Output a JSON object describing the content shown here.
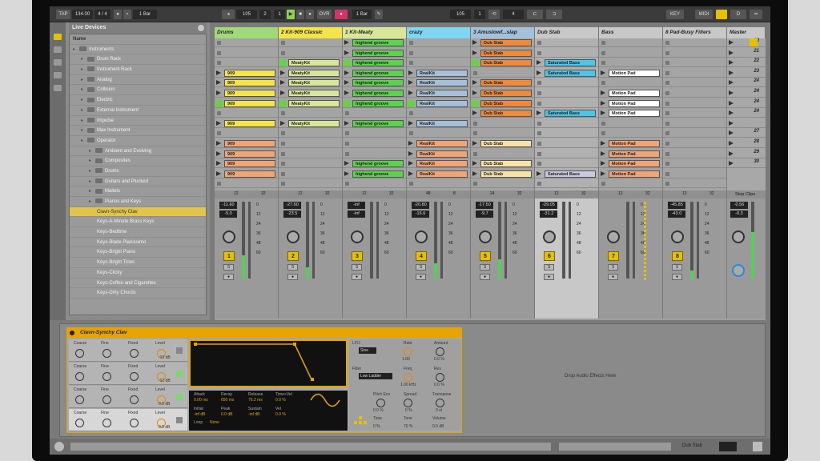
{
  "transport": {
    "tap": "TAP",
    "tempo": "134.00",
    "meter": "4 / 4",
    "loop_pos": "1 Bar",
    "ovr": "OVR",
    "key": "KEY",
    "midi": "MIDI",
    "global_quant": "1 Bar"
  },
  "browser": {
    "title": "Live Devices",
    "items": [
      {
        "label": "Name",
        "indent": 0,
        "type": "head"
      },
      {
        "label": "Instruments",
        "indent": 0,
        "type": "folder"
      },
      {
        "label": "Drum Rack",
        "indent": 1,
        "type": "folder"
      },
      {
        "label": "Instrument Rack",
        "indent": 1,
        "type": "folder"
      },
      {
        "label": "Analog",
        "indent": 1,
        "type": "folder"
      },
      {
        "label": "Collision",
        "indent": 1,
        "type": "folder"
      },
      {
        "label": "Electric",
        "indent": 1,
        "type": "folder"
      },
      {
        "label": "External Instrument",
        "indent": 1,
        "type": "folder"
      },
      {
        "label": "Impulse",
        "indent": 1,
        "type": "folder"
      },
      {
        "label": "Max Instrument",
        "indent": 1,
        "type": "folder"
      },
      {
        "label": "Operator",
        "indent": 1,
        "type": "folder"
      },
      {
        "label": "Ambient and Evolving",
        "indent": 2,
        "type": "folder"
      },
      {
        "label": "Composites",
        "indent": 2,
        "type": "folder"
      },
      {
        "label": "Drums",
        "indent": 2,
        "type": "folder"
      },
      {
        "label": "Guitars and Plucked",
        "indent": 2,
        "type": "folder"
      },
      {
        "label": "Mallets",
        "indent": 2,
        "type": "folder"
      },
      {
        "label": "Pianos and Keys",
        "indent": 2,
        "type": "folder"
      },
      {
        "label": "Clavn-Synchy Clav",
        "indent": 3,
        "type": "item",
        "selected": true
      },
      {
        "label": "Keys-A-Minute Brass Keys",
        "indent": 3,
        "type": "item"
      },
      {
        "label": "Keys-Bedtime",
        "indent": 3,
        "type": "item"
      },
      {
        "label": "Keys-Blade Pianissimo",
        "indent": 3,
        "type": "item"
      },
      {
        "label": "Keys-Bright Piano",
        "indent": 3,
        "type": "item"
      },
      {
        "label": "Keys-Bright Tines",
        "indent": 3,
        "type": "item"
      },
      {
        "label": "Keys-Clicky",
        "indent": 3,
        "type": "item"
      },
      {
        "label": "Keys-Coffee and Cigarettes",
        "indent": 3,
        "type": "item"
      },
      {
        "label": "Keys-Dirty Chords",
        "indent": 3,
        "type": "item"
      }
    ]
  },
  "tracks": [
    {
      "name": "Drums",
      "color": "#9fd97a",
      "number": "1",
      "vol": "-11.60",
      "peak": "-5.0",
      "meter": 0.3,
      "clips": [
        "",
        "",
        "",
        "909",
        "909",
        "909",
        "909",
        "",
        "909",
        "",
        "909",
        "909",
        "909",
        "909",
        ""
      ],
      "clipcolor": [
        "",
        "",
        "",
        "yellow",
        "yellow",
        "yellow",
        "yellow",
        "",
        "yellow",
        "",
        "salmon",
        "salmon",
        "salmon",
        "salmon",
        ""
      ]
    },
    {
      "name": "2 Kit-909 Classic",
      "color": "#f3e44a",
      "number": "2",
      "vol": "-27.60",
      "peak": "-23.5",
      "meter": 0.15,
      "clips": [
        "",
        "",
        "MeatyKit",
        "MeatyKit",
        "MeatyKit",
        "MeatyKit",
        "MeatyKit",
        "",
        "MeatyKit",
        "",
        "",
        "",
        "",
        "",
        ""
      ],
      "clipcolor": [
        "",
        "",
        "lightyellow",
        "lightyellow",
        "lightyellow",
        "lightyellow",
        "lightyellow",
        "",
        "lightyellow",
        "",
        "",
        "",
        "",
        "",
        ""
      ]
    },
    {
      "name": "1 Kit-Meaty",
      "color": "#d8e69a",
      "number": "3",
      "vol": "-inf",
      "peak": "-inf",
      "meter": 0.0,
      "clips": [
        "highend groove",
        "highend groove",
        "highend groove",
        "highend groove",
        "highend groove",
        "highend groove",
        "highend groove",
        "",
        "highend groove",
        "",
        "",
        "",
        "highend groove",
        "highend groove",
        ""
      ],
      "clipcolor": [
        "green",
        "green",
        "green",
        "green",
        "green",
        "green",
        "green",
        "",
        "green",
        "",
        "",
        "",
        "green",
        "green",
        ""
      ]
    },
    {
      "name": "crazy",
      "color": "#7fd6f0",
      "number": "4",
      "vol": "-20.80",
      "peak": "-16.6",
      "meter": 0.2,
      "clips": [
        "",
        "",
        "",
        "RealKit",
        "RealKit",
        "RealKit",
        "RealKit",
        "",
        "RealKit",
        "",
        "RealKit",
        "RealKit",
        "RealKit",
        "RealKit",
        ""
      ],
      "clipcolor": [
        "",
        "",
        "",
        "blue",
        "blue",
        "blue",
        "blue",
        "",
        "blue",
        "",
        "salmon",
        "salmon",
        "salmon",
        "salmon",
        ""
      ]
    },
    {
      "name": "3 Amuslowf...slap",
      "color": "#a5c0d8",
      "number": "5",
      "vol": "-17.50",
      "peak": "-9.7",
      "meter": 0.25,
      "clips": [
        "Dub Stab",
        "Dub Stab",
        "Dub Stab",
        "",
        "Dub Stab",
        "Dub Stab",
        "Dub Stab",
        "Dub Stab",
        "",
        "",
        "Dub Stab",
        "",
        "Dub Stab",
        "Dub Stab",
        ""
      ],
      "clipcolor": [
        "orange",
        "orange",
        "orange",
        "",
        "orange",
        "orange",
        "orange",
        "orange",
        "",
        "",
        "peach",
        "",
        "peach",
        "peach",
        ""
      ]
    },
    {
      "name": "Dub Stab",
      "color": "#c8c8c8",
      "number": "6",
      "vol": "-29.05",
      "peak": "-31.2",
      "meter": 0.0,
      "clips": [
        "",
        "",
        "Saturated Bass",
        "Saturated Bass",
        "",
        "",
        "",
        "Saturated Bass",
        "",
        "",
        "",
        "",
        "",
        "Saturated Bass",
        ""
      ],
      "clipcolor": [
        "",
        "",
        "cyan",
        "cyan",
        "",
        "",
        "",
        "cyan",
        "",
        "",
        "",
        "",
        "",
        "lav",
        ""
      ]
    },
    {
      "name": "Bass",
      "color": "#c8c8c8",
      "number": "7",
      "vol": "",
      "peak": "",
      "meter": 0.0,
      "clips": [
        "",
        "",
        "",
        "Motion Pad",
        "",
        "Motion Pad",
        "Motion Pad",
        "Motion Pad",
        "",
        "",
        "Motion Pad",
        "Motion Pad",
        "Motion Pad",
        "Motion Pad",
        ""
      ],
      "clipcolor": [
        "",
        "",
        "",
        "white",
        "",
        "white",
        "white",
        "white",
        "",
        "",
        "salmon",
        "salmon",
        "salmon",
        "salmon",
        ""
      ]
    },
    {
      "name": "8 Pad-Busy Filters",
      "color": "#c8c8c8",
      "number": "8",
      "vol": "-45.85",
      "peak": "-43.0",
      "meter": 0.1,
      "clips": [],
      "clipcolor": []
    }
  ],
  "master": {
    "name": "Master",
    "scenes": [
      "20",
      "21",
      "22",
      "23",
      "24",
      "24",
      "24",
      "24",
      "",
      "27",
      "28",
      "29",
      "30"
    ],
    "vol": "-0.56",
    "peak": "-0.3",
    "stop_clips": "Stop Clips"
  },
  "mixer_row": [
    "12",
    "32",
    "12",
    "32",
    "12",
    "32",
    "48",
    "8",
    "24",
    "32",
    "12",
    "32",
    "12",
    "32",
    "12",
    "32"
  ],
  "scale_labels": [
    "0",
    "12",
    "24",
    "36",
    "48",
    "60"
  ],
  "device": {
    "title": "Clavn-Synchy Clav",
    "osc_labels": [
      "Coarse",
      "Fine",
      "Fixed",
      "Level"
    ],
    "osc_levels": [
      "-15 dB",
      "-12 dB",
      "0.0 dB",
      "0.0 dB"
    ],
    "env_labels": [
      "Attack",
      "Decay",
      "Release",
      "Time<Vel",
      "Initial",
      "Peak",
      "Sustain",
      "Vel"
    ],
    "env_values": [
      "0.00 ms",
      "650 ms",
      "76.2 ms",
      "0.0 %",
      "-inf dB",
      "0.0 dB",
      "-inf dB",
      "0.0 %"
    ],
    "loop_label": "Loop",
    "loop_value": "None",
    "lfo": {
      "label": "LFO",
      "wave": "Sine",
      "rate_label": "Rate",
      "rate_value": "1.00",
      "amount_label": "Amount",
      "amount_value": "0.0 %"
    },
    "filter": {
      "label": "Filter",
      "type": "Low Ladder",
      "freq_label": "Freq",
      "freq_value": "1.00 kHz",
      "res_label": "Res",
      "res_value": "0.0 %"
    },
    "pitch": {
      "env_label": "Pitch Env",
      "env_value": "0.0 %",
      "spread_label": "Spread",
      "spread_value": "0 %",
      "transpose_label": "Transpose",
      "transpose_value": "0 st"
    },
    "time_label": "Time",
    "time_value": "0 %",
    "tone_label": "Tone",
    "tone_value": "70 %",
    "volume_label": "Volume",
    "volume_value": "0.0 dB"
  },
  "drop_text": "Drop Audio Effects Here",
  "status": {
    "track_name": "Dub Stab"
  }
}
